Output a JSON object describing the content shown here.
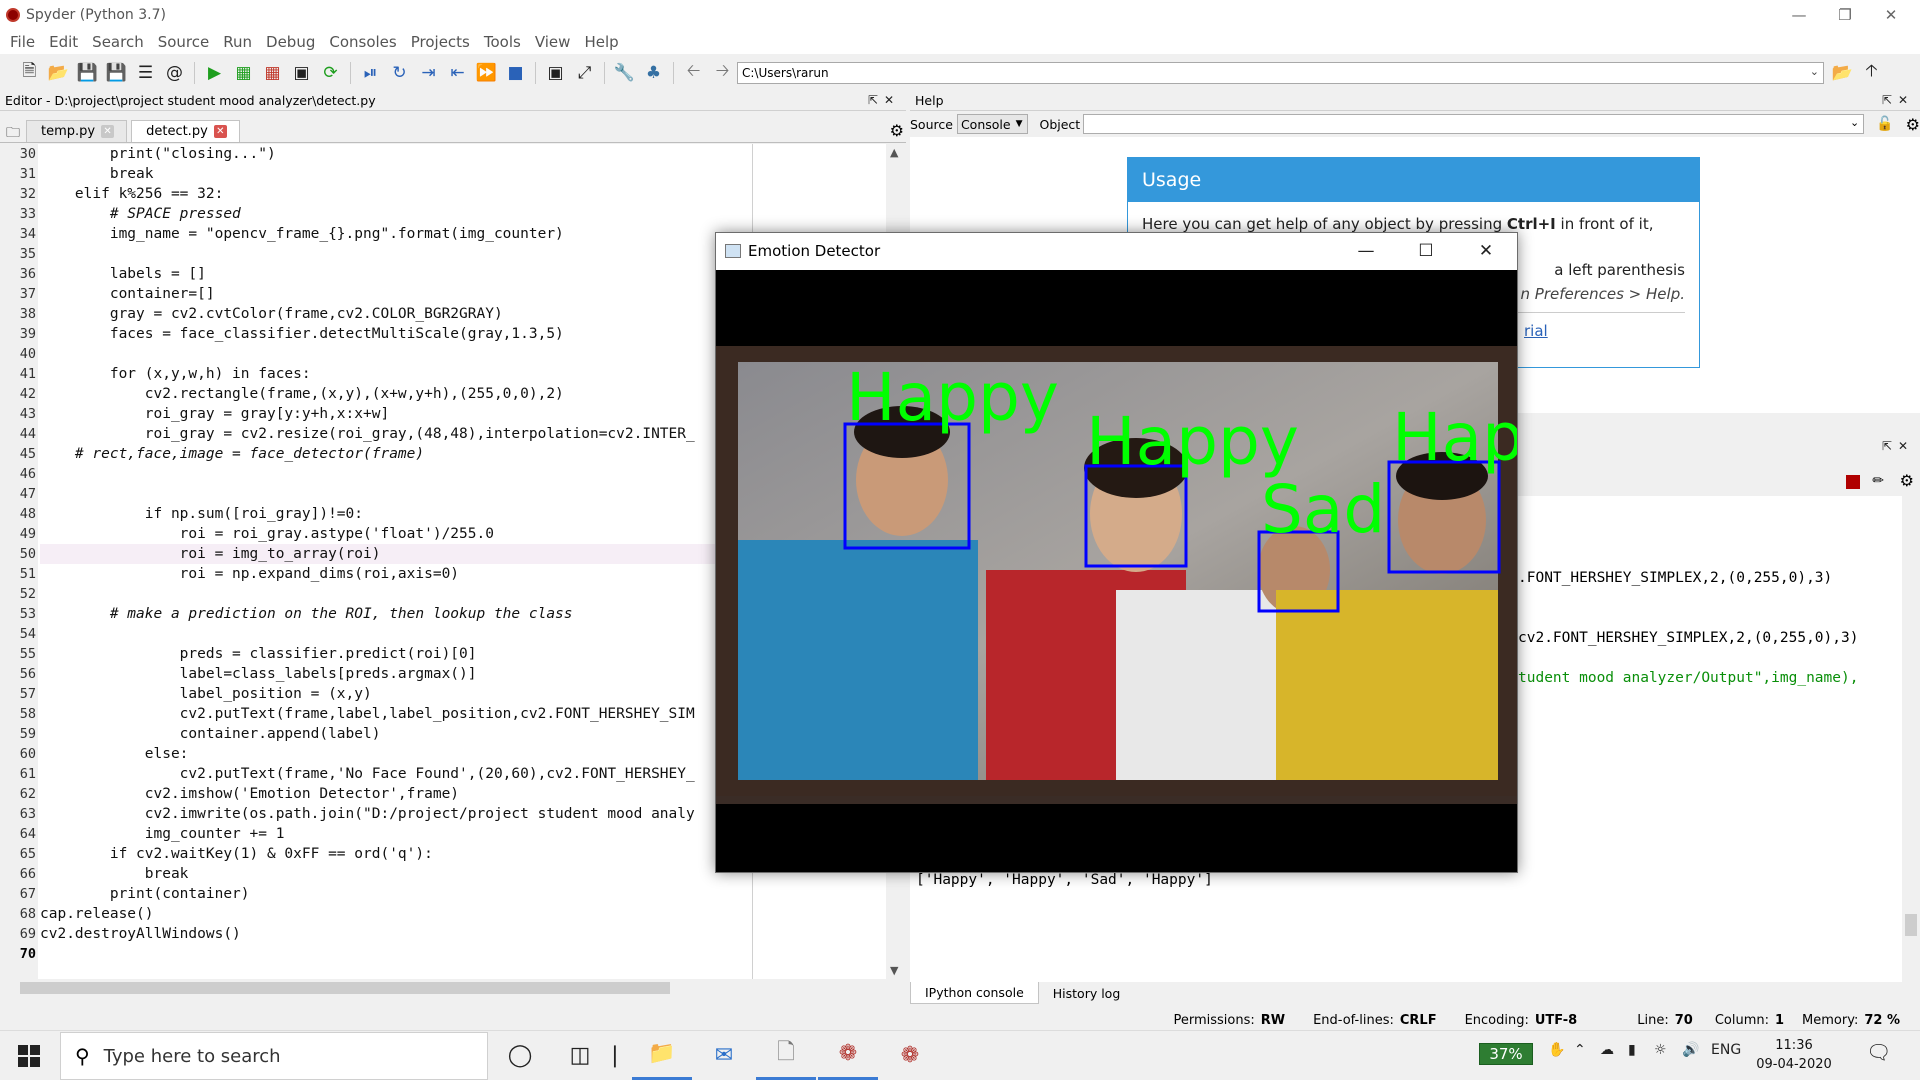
{
  "window": {
    "title": "Spyder (Python 3.7)"
  },
  "menu": [
    "File",
    "Edit",
    "Search",
    "Source",
    "Run",
    "Debug",
    "Consoles",
    "Projects",
    "Tools",
    "View",
    "Help"
  ],
  "toolbar": {
    "path": "C:\\Users\\rarun"
  },
  "editor": {
    "pane_title": "Editor - D:\\project\\project student mood analyzer\\detect.py",
    "tabs": [
      {
        "label": "temp.py"
      },
      {
        "label": "detect.py"
      }
    ],
    "line_numbers": [
      "30",
      "31",
      "32",
      "33",
      "34",
      "35",
      "36",
      "37",
      "38",
      "39",
      "40",
      "41",
      "42",
      "43",
      "44",
      "45",
      "46",
      "47",
      "48",
      "49",
      "50",
      "51",
      "52",
      "53",
      "54",
      "55",
      "56",
      "57",
      "58",
      "59",
      "60",
      "61",
      "62",
      "63",
      "64",
      "65",
      "66",
      "67",
      "68",
      "69",
      "70"
    ],
    "code": [
      "        print(\"closing...\")",
      "        break",
      "    elif k%256 == 32:",
      "        # SPACE pressed",
      "        img_name = \"opencv_frame_{}.png\".format(img_counter)",
      "",
      "        labels = []",
      "        container=[]",
      "        gray = cv2.cvtColor(frame,cv2.COLOR_BGR2GRAY)",
      "        faces = face_classifier.detectMultiScale(gray,1.3,5)",
      "",
      "        for (x,y,w,h) in faces:",
      "            cv2.rectangle(frame,(x,y),(x+w,y+h),(255,0,0),2)",
      "            roi_gray = gray[y:y+h,x:x+w]",
      "            roi_gray = cv2.resize(roi_gray,(48,48),interpolation=cv2.INTER_",
      "    # rect,face,image = face_detector(frame)",
      "",
      "",
      "            if np.sum([roi_gray])!=0:",
      "                roi = roi_gray.astype('float')/255.0",
      "                roi = img_to_array(roi)",
      "                roi = np.expand_dims(roi,axis=0)",
      "",
      "        # make a prediction on the ROI, then lookup the class",
      "",
      "                preds = classifier.predict(roi)[0]",
      "                label=class_labels[preds.argmax()]",
      "                label_position = (x,y)",
      "                cv2.putText(frame,label,label_position,cv2.FONT_HERSHEY_SIM",
      "                container.append(label)",
      "            else:",
      "                cv2.putText(frame,'No Face Found',(20,60),cv2.FONT_HERSHEY_",
      "            cv2.imshow('Emotion Detector',frame)",
      "            cv2.imwrite(os.path.join(\"D:/project/project student mood analy",
      "            img_counter += 1",
      "        if cv2.waitKey(1) & 0xFF == ord('q'):",
      "            break",
      "        print(container)",
      "cap.release()",
      "cv2.destroyAllWindows()",
      ""
    ]
  },
  "help": {
    "pane_title": "Help",
    "source_label": "Source",
    "source_value": "Console",
    "object_label": "Object",
    "usage_title": "Usage",
    "usage_line1_pre": "Here you can get help of any object by pressing ",
    "usage_line1_key": "Ctrl+I",
    "usage_line1_post": " in front of it,",
    "usage_line2": "a left parenthesis",
    "usage_line3": "n Preferences > Help.",
    "usage_link": "rial"
  },
  "console": {
    "line1": ".FONT_HERSHEY_SIMPLEX,2,(0,255,0),3)",
    "line2": "cv2.FONT_HERSHEY_SIMPLEX,2,(0,255,0),3)",
    "line3": "tudent mood analyzer/Output\",img_name),",
    "output": "['Happy', 'Happy', 'Sad', 'Happy']",
    "tabs": [
      "IPython console",
      "History log"
    ]
  },
  "emotion_window": {
    "title": "Emotion Detector",
    "labels": [
      "Happy",
      "Happy",
      "Sad",
      "Hap"
    ]
  },
  "statusbar": {
    "permissions_label": "Permissions:",
    "permissions": "RW",
    "eol_label": "End-of-lines:",
    "eol": "CRLF",
    "encoding_label": "Encoding:",
    "encoding": "UTF-8",
    "line_label": "Line:",
    "line": "70",
    "column_label": "Column:",
    "column": "1",
    "memory_label": "Memory:",
    "memory": "72 %"
  },
  "taskbar": {
    "search_placeholder": "Type here to search",
    "battery": "37%",
    "language": "ENG",
    "time": "11:36",
    "date": "09-04-2020"
  },
  "colors": {
    "accent": "#3498db",
    "detect_box": "#0000ff",
    "detect_label": "#00ff00",
    "run_green": "#1e9e1e"
  }
}
